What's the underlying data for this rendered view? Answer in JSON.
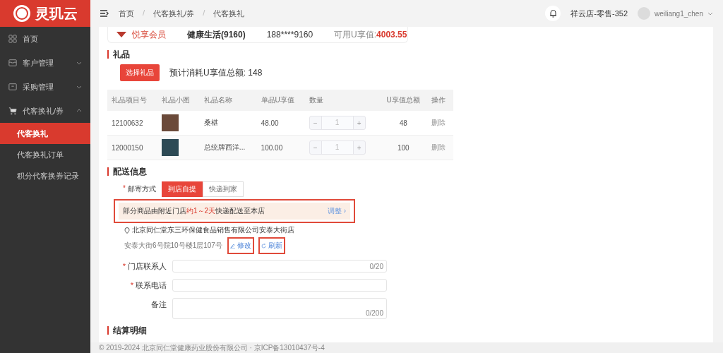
{
  "sidebar": {
    "logo": "灵玑云",
    "items": [
      {
        "label": "首页"
      },
      {
        "label": "客户管理",
        "expanded": false
      },
      {
        "label": "采购管理",
        "expanded": false
      },
      {
        "label": "代客换礼/券",
        "expanded": true,
        "children": [
          {
            "label": "代客换礼",
            "selected": true
          },
          {
            "label": "代客换礼订单",
            "selected": false
          },
          {
            "label": "积分代客换券记录",
            "selected": false
          }
        ]
      }
    ]
  },
  "header": {
    "breadcrumb": [
      "首页",
      "代客换礼/券",
      "代客换礼"
    ],
    "separator": "/",
    "store": "祥云店-零售-352",
    "user": "weiliang1_chen"
  },
  "member_card": {
    "level": "悦享会员",
    "name": "健康生活(9160)",
    "phone": "188****9160",
    "points_label": "可用U享值:",
    "points": "4003.55"
  },
  "gifts": {
    "title": "礼品",
    "select_button": "选择礼品",
    "total": "预计消耗U享值总额: 148",
    "columns": [
      "礼品项目号",
      "礼品小图",
      "礼品名称",
      "单品U享值",
      "数量",
      "U享值总额",
      "操作"
    ],
    "rows": [
      {
        "id": "12100632",
        "name": "桑椹",
        "price": "48.00",
        "qty": "1",
        "minus": "−",
        "plus": "+",
        "total": "48",
        "action": "删除"
      },
      {
        "id": "12000150",
        "name": "总统牌西洋...",
        "price": "100.00",
        "qty": "1",
        "minus": "−",
        "plus": "+",
        "total": "100",
        "action": "删除"
      }
    ]
  },
  "delivery": {
    "title": "配送信息",
    "method_label": "邮寄方式",
    "methods": [
      {
        "label": "到店自提",
        "selected": true
      },
      {
        "label": "快递到家",
        "selected": false
      }
    ],
    "notice": {
      "before": "部分商品由附近门店",
      "highlight": "约1～2天",
      "after": "快递配送至本店",
      "link": "调整",
      "link_arrow": "›",
      "highlighted": true
    },
    "store_name": "北京同仁堂东三环保健食品销售有限公司安泰大街店",
    "address": "安泰大街6号院10号楼1层107号",
    "actions": [
      {
        "kind": "edit",
        "label": "修改",
        "highlighted": true
      },
      {
        "kind": "refresh",
        "label": "刷新",
        "highlighted": true
      }
    ],
    "required_mark": "*",
    "method_required": true,
    "fields": [
      {
        "label": "门店联系人",
        "required": true,
        "kind": "input",
        "counter": "0/20"
      },
      {
        "label": "联系电话",
        "required": true,
        "kind": "input"
      },
      {
        "label": "备注",
        "required": false,
        "kind": "textarea",
        "counter": "0/200"
      }
    ]
  },
  "settlement": {
    "title": "结算明细"
  },
  "footer": "© 2019-2024 北京同仁堂健康药业股份有限公司 · 京ICP备13010437号-4"
}
